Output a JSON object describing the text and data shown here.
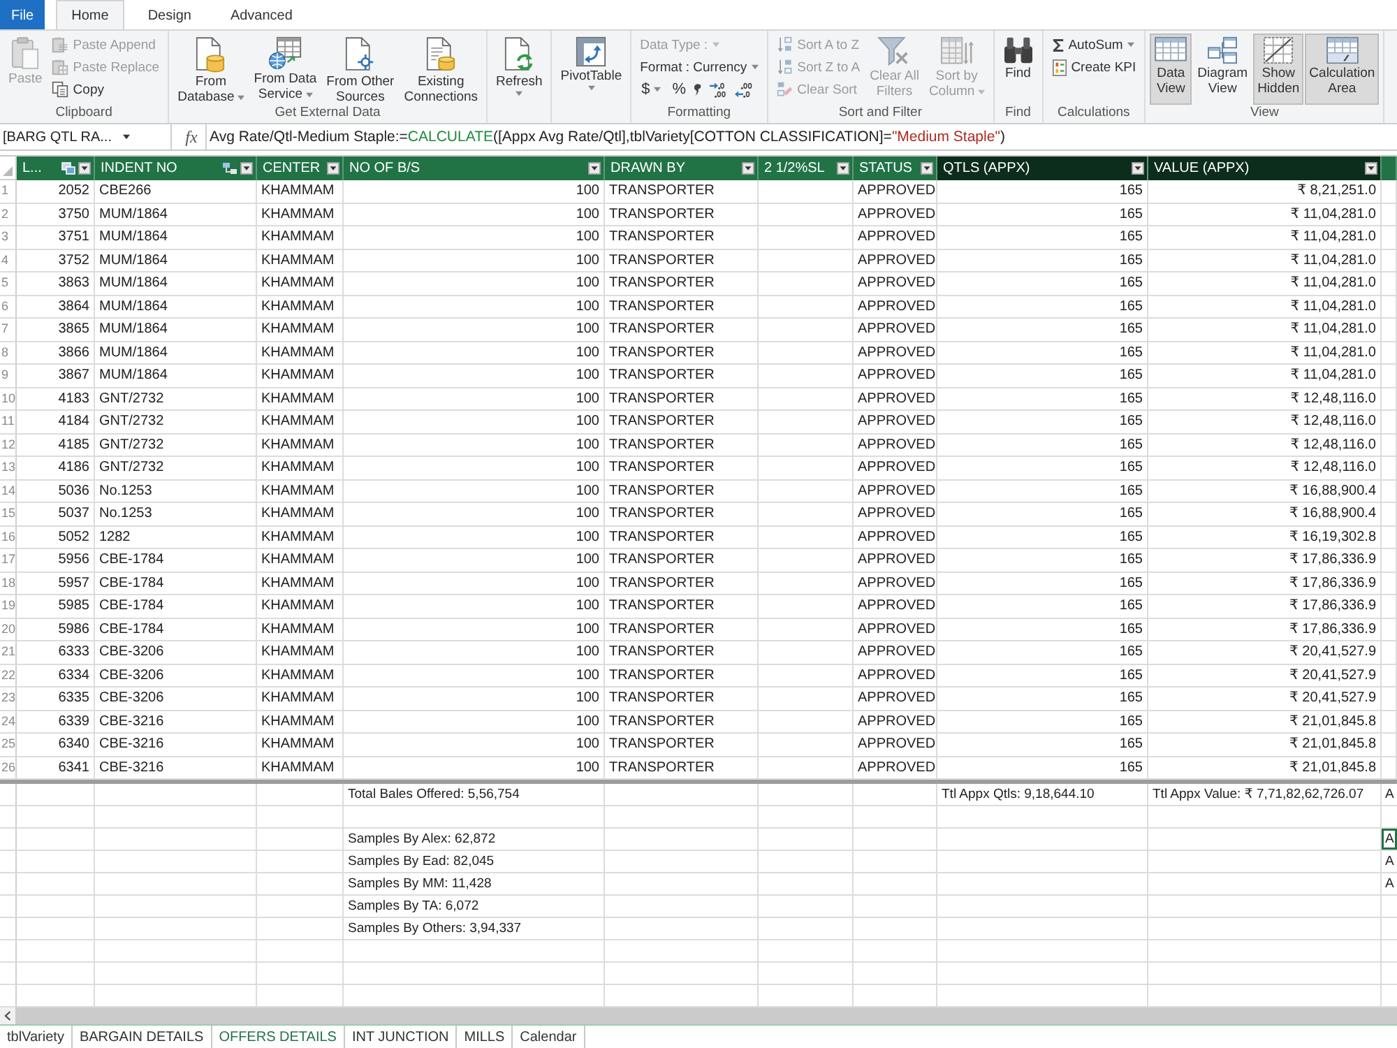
{
  "ribbon": {
    "tabs": [
      {
        "label": "File",
        "kind": "file",
        "selected": false
      },
      {
        "label": "Home",
        "kind": "tab",
        "selected": true
      },
      {
        "label": "Design",
        "kind": "tab",
        "selected": false
      },
      {
        "label": "Advanced",
        "kind": "tab",
        "selected": false
      }
    ],
    "clipboard": {
      "label": "Clipboard",
      "paste": {
        "label": "Paste",
        "disabled": true
      },
      "paste_append": {
        "label": "Paste Append",
        "disabled": true
      },
      "paste_replace": {
        "label": "Paste Replace",
        "disabled": true
      },
      "copy": {
        "label": "Copy",
        "disabled": false
      }
    },
    "external_data": {
      "label": "Get External Data",
      "from_database": {
        "lines": [
          "From",
          "Database"
        ],
        "menu": true
      },
      "from_data_service": {
        "lines": [
          "From Data",
          "Service"
        ],
        "menu": true
      },
      "from_other_sources": {
        "lines": [
          "From Other",
          "Sources"
        ]
      },
      "existing_connections": {
        "lines": [
          "Existing",
          "Connections"
        ]
      }
    },
    "refresh": {
      "label": "Refresh",
      "menu": true
    },
    "pivot_table": {
      "label": "PivotTable",
      "menu": true
    },
    "formatting": {
      "label": "Formatting",
      "data_type": {
        "label": "Data Type :",
        "disabled": true,
        "menu": true
      },
      "format": {
        "label": "Format : Currency",
        "disabled": false,
        "menu": true
      },
      "currency": {
        "label": "$",
        "menu": true
      },
      "percent": {
        "label": "%"
      }
    },
    "sort_filter": {
      "label": "Sort and Filter",
      "sort_a_to_z": {
        "label": "Sort A to Z",
        "disabled": true
      },
      "sort_z_to_a": {
        "label": "Sort Z to A",
        "disabled": true
      },
      "clear_sort": {
        "label": "Clear Sort",
        "disabled": true
      },
      "clear_all_filters": {
        "lines": [
          "Clear All",
          "Filters"
        ],
        "disabled": true
      },
      "sort_by_column": {
        "lines": [
          "Sort by",
          "Column"
        ],
        "disabled": true,
        "menu": true
      }
    },
    "find": {
      "label": "Find",
      "button": {
        "label": "Find"
      }
    },
    "calculations": {
      "label": "Calculations",
      "autosum": {
        "label": "AutoSum",
        "menu": true
      },
      "create_kpi": {
        "label": "Create KPI"
      }
    },
    "view": {
      "label": "View",
      "data_view": {
        "lines": [
          "Data",
          "View"
        ],
        "selected": true
      },
      "diagram_view": {
        "lines": [
          "Diagram",
          "View"
        ],
        "selected": false
      },
      "show_hidden": {
        "lines": [
          "Show",
          "Hidden"
        ],
        "selected": true
      },
      "calculation_area": {
        "lines": [
          "Calculation",
          "Area"
        ],
        "selected": true
      }
    }
  },
  "formula_bar": {
    "name_box": "[BARG QTL RA...",
    "function_button": "fx",
    "formula": [
      {
        "kind": "text",
        "text": "Avg Rate/Qtl-Medium Staple:="
      },
      {
        "kind": "function",
        "text": "CALCULATE"
      },
      {
        "kind": "text",
        "text": "([Appx Avg Rate/Qtl],tblVariety[COTTON CLASSIFICATION]="
      },
      {
        "kind": "string",
        "text": "\"Medium Staple\""
      },
      {
        "kind": "text",
        "text": ")"
      }
    ]
  },
  "table": {
    "columns": [
      {
        "label": "L...",
        "kind": "linked",
        "selected": false
      },
      {
        "label": "INDENT NO",
        "kind": "lookup",
        "selected": false
      },
      {
        "label": "CENTER",
        "kind": "plain",
        "selected": false
      },
      {
        "label": "NO OF B/S",
        "kind": "plain",
        "selected": false
      },
      {
        "label": "DRAWN BY",
        "kind": "plain",
        "selected": false
      },
      {
        "label": "2 1/2%SL",
        "kind": "plain",
        "selected": false
      },
      {
        "label": "STATUS",
        "kind": "plain",
        "selected": false
      },
      {
        "label": "QTLS (APPX)",
        "kind": "plain",
        "selected": true
      },
      {
        "label": "VALUE (APPX)",
        "kind": "plain",
        "selected": true
      }
    ],
    "rows": [
      {
        "row_number": "1",
        "column_1": "2052",
        "indent_no": "CBE266",
        "center": "KHAMMAM",
        "no_of_bs": "100",
        "drawn_by": "TRANSPORTER",
        "status": "APPROVED",
        "qtls_appx": "165",
        "value_appx": "₹ 8,21,251.0"
      },
      {
        "row_number": "2",
        "column_1": "3750",
        "indent_no": "MUM/1864",
        "center": "KHAMMAM",
        "no_of_bs": "100",
        "drawn_by": "TRANSPORTER",
        "status": "APPROVED",
        "qtls_appx": "165",
        "value_appx": "₹ 11,04,281.0"
      },
      {
        "row_number": "3",
        "column_1": "3751",
        "indent_no": "MUM/1864",
        "center": "KHAMMAM",
        "no_of_bs": "100",
        "drawn_by": "TRANSPORTER",
        "status": "APPROVED",
        "qtls_appx": "165",
        "value_appx": "₹ 11,04,281.0"
      },
      {
        "row_number": "4",
        "column_1": "3752",
        "indent_no": "MUM/1864",
        "center": "KHAMMAM",
        "no_of_bs": "100",
        "drawn_by": "TRANSPORTER",
        "status": "APPROVED",
        "qtls_appx": "165",
        "value_appx": "₹ 11,04,281.0"
      },
      {
        "row_number": "5",
        "column_1": "3863",
        "indent_no": "MUM/1864",
        "center": "KHAMMAM",
        "no_of_bs": "100",
        "drawn_by": "TRANSPORTER",
        "status": "APPROVED",
        "qtls_appx": "165",
        "value_appx": "₹ 11,04,281.0"
      },
      {
        "row_number": "6",
        "column_1": "3864",
        "indent_no": "MUM/1864",
        "center": "KHAMMAM",
        "no_of_bs": "100",
        "drawn_by": "TRANSPORTER",
        "status": "APPROVED",
        "qtls_appx": "165",
        "value_appx": "₹ 11,04,281.0"
      },
      {
        "row_number": "7",
        "column_1": "3865",
        "indent_no": "MUM/1864",
        "center": "KHAMMAM",
        "no_of_bs": "100",
        "drawn_by": "TRANSPORTER",
        "status": "APPROVED",
        "qtls_appx": "165",
        "value_appx": "₹ 11,04,281.0"
      },
      {
        "row_number": "8",
        "column_1": "3866",
        "indent_no": "MUM/1864",
        "center": "KHAMMAM",
        "no_of_bs": "100",
        "drawn_by": "TRANSPORTER",
        "status": "APPROVED",
        "qtls_appx": "165",
        "value_appx": "₹ 11,04,281.0"
      },
      {
        "row_number": "9",
        "column_1": "3867",
        "indent_no": "MUM/1864",
        "center": "KHAMMAM",
        "no_of_bs": "100",
        "drawn_by": "TRANSPORTER",
        "status": "APPROVED",
        "qtls_appx": "165",
        "value_appx": "₹ 11,04,281.0"
      },
      {
        "row_number": "10",
        "column_1": "4183",
        "indent_no": "GNT/2732",
        "center": "KHAMMAM",
        "no_of_bs": "100",
        "drawn_by": "TRANSPORTER",
        "status": "APPROVED",
        "qtls_appx": "165",
        "value_appx": "₹ 12,48,116.0"
      },
      {
        "row_number": "11",
        "column_1": "4184",
        "indent_no": "GNT/2732",
        "center": "KHAMMAM",
        "no_of_bs": "100",
        "drawn_by": "TRANSPORTER",
        "status": "APPROVED",
        "qtls_appx": "165",
        "value_appx": "₹ 12,48,116.0"
      },
      {
        "row_number": "12",
        "column_1": "4185",
        "indent_no": "GNT/2732",
        "center": "KHAMMAM",
        "no_of_bs": "100",
        "drawn_by": "TRANSPORTER",
        "status": "APPROVED",
        "qtls_appx": "165",
        "value_appx": "₹ 12,48,116.0"
      },
      {
        "row_number": "13",
        "column_1": "4186",
        "indent_no": "GNT/2732",
        "center": "KHAMMAM",
        "no_of_bs": "100",
        "drawn_by": "TRANSPORTER",
        "status": "APPROVED",
        "qtls_appx": "165",
        "value_appx": "₹ 12,48,116.0"
      },
      {
        "row_number": "14",
        "column_1": "5036",
        "indent_no": "No.1253",
        "center": "KHAMMAM",
        "no_of_bs": "100",
        "drawn_by": "TRANSPORTER",
        "status": "APPROVED",
        "qtls_appx": "165",
        "value_appx": "₹ 16,88,900.4"
      },
      {
        "row_number": "15",
        "column_1": "5037",
        "indent_no": "No.1253",
        "center": "KHAMMAM",
        "no_of_bs": "100",
        "drawn_by": "TRANSPORTER",
        "status": "APPROVED",
        "qtls_appx": "165",
        "value_appx": "₹ 16,88,900.4"
      },
      {
        "row_number": "16",
        "column_1": "5052",
        "indent_no": "1282",
        "center": "KHAMMAM",
        "no_of_bs": "100",
        "drawn_by": "TRANSPORTER",
        "status": "APPROVED",
        "qtls_appx": "165",
        "value_appx": "₹ 16,19,302.8"
      },
      {
        "row_number": "17",
        "column_1": "5956",
        "indent_no": "CBE-1784",
        "center": "KHAMMAM",
        "no_of_bs": "100",
        "drawn_by": "TRANSPORTER",
        "status": "APPROVED",
        "qtls_appx": "165",
        "value_appx": "₹ 17,86,336.9"
      },
      {
        "row_number": "18",
        "column_1": "5957",
        "indent_no": "CBE-1784",
        "center": "KHAMMAM",
        "no_of_bs": "100",
        "drawn_by": "TRANSPORTER",
        "status": "APPROVED",
        "qtls_appx": "165",
        "value_appx": "₹ 17,86,336.9"
      },
      {
        "row_number": "19",
        "column_1": "5985",
        "indent_no": "CBE-1784",
        "center": "KHAMMAM",
        "no_of_bs": "100",
        "drawn_by": "TRANSPORTER",
        "status": "APPROVED",
        "qtls_appx": "165",
        "value_appx": "₹ 17,86,336.9"
      },
      {
        "row_number": "20",
        "column_1": "5986",
        "indent_no": "CBE-1784",
        "center": "KHAMMAM",
        "no_of_bs": "100",
        "drawn_by": "TRANSPORTER",
        "status": "APPROVED",
        "qtls_appx": "165",
        "value_appx": "₹ 17,86,336.9"
      },
      {
        "row_number": "21",
        "column_1": "6333",
        "indent_no": "CBE-3206",
        "center": "KHAMMAM",
        "no_of_bs": "100",
        "drawn_by": "TRANSPORTER",
        "status": "APPROVED",
        "qtls_appx": "165",
        "value_appx": "₹ 20,41,527.9"
      },
      {
        "row_number": "22",
        "column_1": "6334",
        "indent_no": "CBE-3206",
        "center": "KHAMMAM",
        "no_of_bs": "100",
        "drawn_by": "TRANSPORTER",
        "status": "APPROVED",
        "qtls_appx": "165",
        "value_appx": "₹ 20,41,527.9"
      },
      {
        "row_number": "23",
        "column_1": "6335",
        "indent_no": "CBE-3206",
        "center": "KHAMMAM",
        "no_of_bs": "100",
        "drawn_by": "TRANSPORTER",
        "status": "APPROVED",
        "qtls_appx": "165",
        "value_appx": "₹ 20,41,527.9"
      },
      {
        "row_number": "24",
        "column_1": "6339",
        "indent_no": "CBE-3216",
        "center": "KHAMMAM",
        "no_of_bs": "100",
        "drawn_by": "TRANSPORTER",
        "status": "APPROVED",
        "qtls_appx": "165",
        "value_appx": "₹ 21,01,845.8"
      },
      {
        "row_number": "25",
        "column_1": "6340",
        "indent_no": "CBE-3216",
        "center": "KHAMMAM",
        "no_of_bs": "100",
        "drawn_by": "TRANSPORTER",
        "status": "APPROVED",
        "qtls_appx": "165",
        "value_appx": "₹ 21,01,845.8"
      },
      {
        "row_number": "26",
        "column_1": "6341",
        "indent_no": "CBE-3216",
        "center": "KHAMMAM",
        "no_of_bs": "100",
        "drawn_by": "TRANSPORTER",
        "status": "APPROVED",
        "qtls_appx": "165",
        "value_appx": "₹ 21,01,845.8"
      }
    ]
  },
  "calc_area": {
    "totals": {
      "no_of_bs": "Total Bales Offered: 5,56,754",
      "qtls_appx": "Ttl Appx Qtls: 9,18,644.10",
      "value_appx": "Ttl Appx Value: ₹ 7,71,82,62,726.07",
      "column_10": "A"
    },
    "samples": [
      {
        "no_of_bs": "Samples By Alex: 62,872",
        "column_10": "A",
        "selected": true
      },
      {
        "no_of_bs": "Samples By Ead: 82,045",
        "column_10": "A",
        "selected": false
      },
      {
        "no_of_bs": "Samples By MM: 11,428",
        "column_10": "A",
        "selected": false
      },
      {
        "no_of_bs": "Samples By TA: 6,072",
        "selected": false
      },
      {
        "no_of_bs": "Samples By Others: 3,94,337",
        "selected": false
      }
    ]
  },
  "sheet_tabs": [
    {
      "label": "tblVariety",
      "selected": false
    },
    {
      "label": "BARGAIN DETAILS",
      "selected": false
    },
    {
      "label": "OFFERS DETAILS",
      "selected": true
    },
    {
      "label": "INT JUNCTION",
      "selected": false
    },
    {
      "label": "MILLS",
      "selected": false
    },
    {
      "label": "Calendar",
      "selected": false
    }
  ]
}
